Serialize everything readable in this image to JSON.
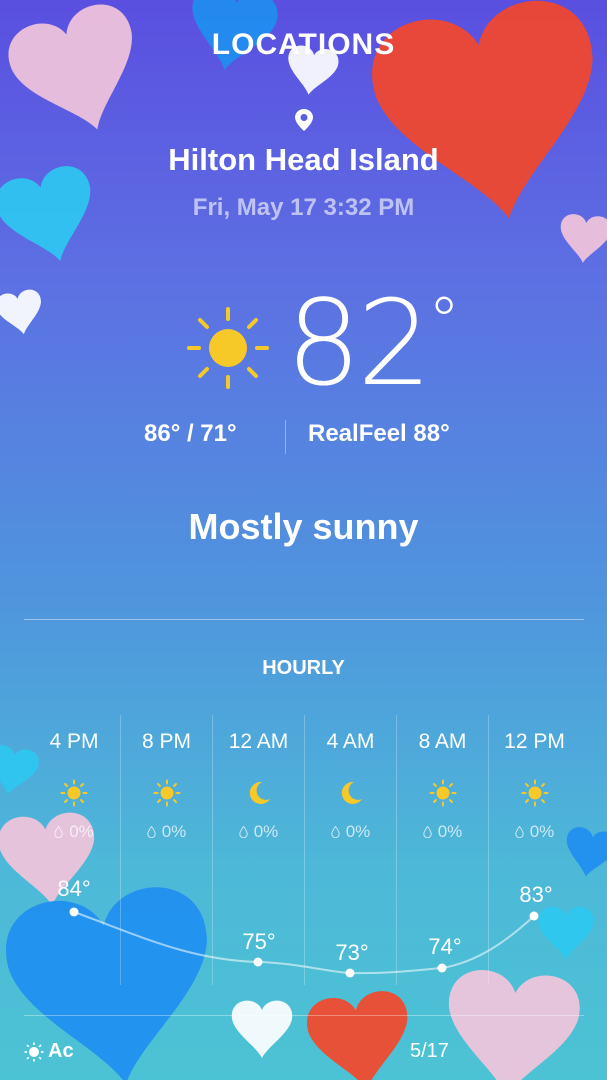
{
  "header": {
    "title": "LOCATIONS",
    "location": "Hilton Head Island",
    "datetime": "Fri, May 17 3:32 PM"
  },
  "current": {
    "icon": "sun-icon",
    "temperature": "82",
    "degree": "°",
    "hi_lo": "86°  / 71°",
    "realfeel": "RealFeel 88°",
    "condition": "Mostly sunny"
  },
  "hourly": {
    "title": "HOURLY",
    "items": [
      {
        "time": "4 PM",
        "icon": "sun-icon",
        "precip": "0%",
        "temp": "84°"
      },
      {
        "time": "8 PM",
        "icon": "sun-icon",
        "precip": "0%",
        "temp": ""
      },
      {
        "time": "12 AM",
        "icon": "moon-icon",
        "precip": "0%",
        "temp": "75°"
      },
      {
        "time": "4 AM",
        "icon": "moon-icon",
        "precip": "0%",
        "temp": "73°"
      },
      {
        "time": "8 AM",
        "icon": "sun-icon",
        "precip": "0%",
        "temp": "74°"
      },
      {
        "time": "12 PM",
        "icon": "sun-icon",
        "precip": "0%",
        "temp": "83°"
      }
    ]
  },
  "footer": {
    "left_text": "Ac",
    "right_text": "5/17"
  },
  "colors": {
    "sun": "#f7c928",
    "heart_red": "#f5472a",
    "heart_blue": "#1f8ff0",
    "heart_pink": "#f4c6dc",
    "heart_cyan": "#2ec8f0"
  }
}
